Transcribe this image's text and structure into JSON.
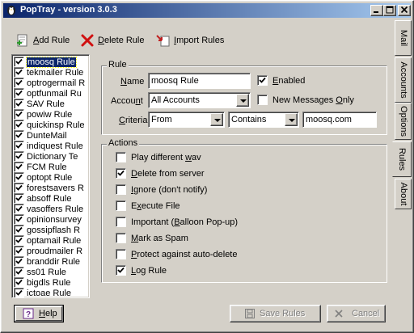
{
  "window": {
    "title": "PopTray - version 3.0.3",
    "controls": [
      "minimize",
      "maximize",
      "close"
    ]
  },
  "toolbar": {
    "add_label_ul": "A",
    "add_label_rest": "dd Rule",
    "delete_label_ul": "D",
    "delete_label_rest": "elete Rule",
    "import_label_ul": "I",
    "import_label_rest": "mport Rules"
  },
  "rules_list": {
    "items": [
      {
        "label": "moosq Rule",
        "checked": true,
        "selected": true
      },
      {
        "label": "tekmailer Rule",
        "checked": true
      },
      {
        "label": "optrogermail R",
        "checked": true
      },
      {
        "label": "optfunmail Ru",
        "checked": true
      },
      {
        "label": "SAV Rule",
        "checked": true
      },
      {
        "label": "powiw Rule",
        "checked": true
      },
      {
        "label": "quickinsp Rule",
        "checked": true
      },
      {
        "label": "DunteMail",
        "checked": true
      },
      {
        "label": "indiquest Rule",
        "checked": true
      },
      {
        "label": "Dictionary Te",
        "checked": true
      },
      {
        "label": "FCM Rule",
        "checked": true
      },
      {
        "label": "optopt Rule",
        "checked": true
      },
      {
        "label": "forestsavers R",
        "checked": true
      },
      {
        "label": "absoff Rule",
        "checked": true
      },
      {
        "label": "vasoffers Rule",
        "checked": true
      },
      {
        "label": "opinionsurvey",
        "checked": true
      },
      {
        "label": "gossipflash R",
        "checked": true
      },
      {
        "label": "optamail Rule",
        "checked": true
      },
      {
        "label": "proudmailer R",
        "checked": true
      },
      {
        "label": "branddir Rule",
        "checked": true
      },
      {
        "label": "ss01 Rule",
        "checked": true
      },
      {
        "label": "bigdls Rule",
        "checked": true
      },
      {
        "label": "ictoae Rule",
        "checked": true
      }
    ]
  },
  "rule_group": {
    "title": "Rule",
    "name_label_ul": "N",
    "name_label_rest": "ame",
    "name_value": "moosq Rule",
    "enabled_label_ul": "E",
    "enabled_label_rest": "nabled",
    "enabled_checked": true,
    "account_label_pre": "Accou",
    "account_label_ul": "n",
    "account_label_post": "t",
    "account_value": "All Accounts",
    "new_only_label_pre": "New Messages ",
    "new_only_label_ul": "O",
    "new_only_label_post": "nly",
    "new_only_checked": false,
    "criteria_label_ul": "C",
    "criteria_label_rest": "riteria",
    "criteria_field": "From",
    "criteria_op": "Contains",
    "criteria_value": "moosq.com"
  },
  "actions_group": {
    "title": "Actions",
    "items": [
      {
        "pre": "Play different ",
        "ul": "w",
        "post": "av",
        "checked": false
      },
      {
        "pre": "",
        "ul": "D",
        "post": "elete from server",
        "checked": true
      },
      {
        "pre": "",
        "ul": "I",
        "post": "gnore (don't notify)",
        "checked": false
      },
      {
        "pre": "E",
        "ul": "x",
        "post": "ecute File",
        "checked": false
      },
      {
        "pre": "Important (",
        "ul": "B",
        "post": "alloon Pop-up)",
        "checked": false
      },
      {
        "pre": "",
        "ul": "M",
        "post": "ark as Spam",
        "checked": false
      },
      {
        "pre": "",
        "ul": "P",
        "post": "rotect against auto-delete",
        "checked": false
      },
      {
        "pre": "",
        "ul": "L",
        "post": "og Rule",
        "checked": true
      }
    ]
  },
  "footer": {
    "help_ul": "H",
    "help_rest": "elp",
    "save_label": "Save Rules",
    "cancel_label": "Cancel"
  },
  "tabs": [
    {
      "label": "Mail",
      "active": false
    },
    {
      "label": "Accounts",
      "active": false
    },
    {
      "label": "Options",
      "active": false
    },
    {
      "label": "Rules",
      "active": true
    },
    {
      "label": "About",
      "active": false
    }
  ],
  "colors": {
    "face": "#d4d0c8",
    "title_start": "#0a246a",
    "title_end": "#a6caf0",
    "selection": "#0a246a"
  }
}
